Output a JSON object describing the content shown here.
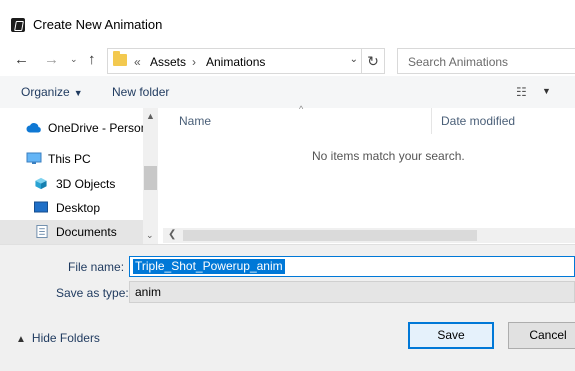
{
  "window": {
    "title": "Create New Animation"
  },
  "address_bar": {
    "crumbs": [
      "«",
      "Assets",
      "›",
      "Animations"
    ],
    "search_placeholder": "Search Animations"
  },
  "toolbar": {
    "organize_label": "Organize",
    "new_folder_label": "New folder"
  },
  "nav": {
    "items": [
      {
        "label": "OneDrive - Person",
        "icon": "cloud-icon"
      },
      {
        "label": "This PC",
        "icon": "computer-icon"
      },
      {
        "label": "3D Objects",
        "icon": "cube-icon"
      },
      {
        "label": "Desktop",
        "icon": "desktop-icon"
      },
      {
        "label": "Documents",
        "icon": "document-icon",
        "selected": true
      }
    ]
  },
  "files": {
    "columns": [
      "Name",
      "Date modified"
    ],
    "empty_message": "No items match your search."
  },
  "form": {
    "filename_label": "File name:",
    "filename_value": "Triple_Shot_Powerup_anim",
    "savetype_label": "Save as type:",
    "savetype_value": "anim"
  },
  "footer": {
    "hide_folders_label": "Hide Folders",
    "save_label": "Save",
    "cancel_label": "Cancel"
  },
  "colors": {
    "accent": "#0078d7",
    "folder": "#f3c94f"
  }
}
